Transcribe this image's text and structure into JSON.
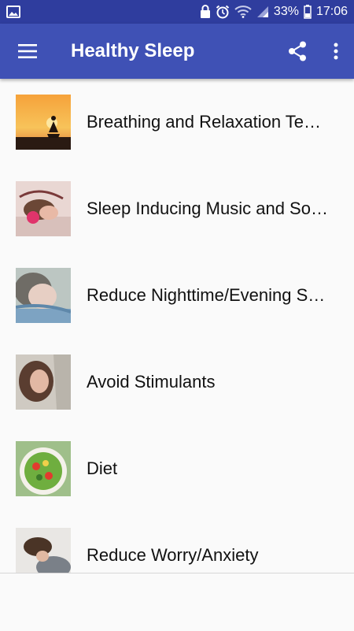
{
  "status_bar": {
    "battery": "33%",
    "time": "17:06",
    "icons": [
      "image-notification-icon",
      "lock-notification-icon",
      "alarm-icon",
      "wifi-icon",
      "signal-icon",
      "battery-icon"
    ]
  },
  "app_bar": {
    "title": "Healthy Sleep",
    "icons": [
      "menu-icon",
      "share-icon",
      "more-vert-icon"
    ]
  },
  "list": {
    "items": [
      {
        "label": "Breathing and Relaxation Te…"
      },
      {
        "label": "Sleep Inducing Music and So…"
      },
      {
        "label": "Reduce Nighttime/Evening S…"
      },
      {
        "label": "Avoid Stimulants"
      },
      {
        "label": "Diet"
      },
      {
        "label": "Reduce Worry/Anxiety"
      }
    ]
  },
  "colors": {
    "status_bar": "#2f3d9e",
    "app_bar": "#3f51b5",
    "background": "#fafafa"
  }
}
